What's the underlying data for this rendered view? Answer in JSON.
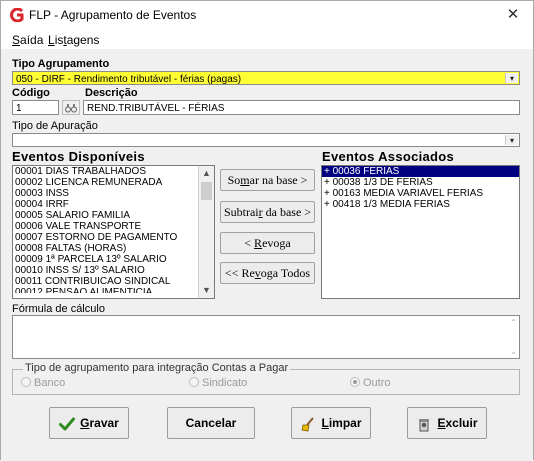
{
  "window": {
    "title": "FLP - Agrupamento de Eventos",
    "close_glyph": "✕"
  },
  "menu": {
    "items": [
      {
        "accel": "S",
        "rest": "aída"
      },
      {
        "accel": "L",
        "rest": "is",
        "accel2": "t",
        "rest2": "agens"
      }
    ]
  },
  "tipo_agrupamento": {
    "label": "Tipo Agrupamento",
    "value": "050 - DIRF - Rendimento tributável - férias (pagas)"
  },
  "codigo": {
    "label": "Código",
    "value": "1"
  },
  "descricao": {
    "label": "Descrição",
    "value": "REND.TRIBUTÁVEL - FÉRIAS"
  },
  "tipo_apuracao": {
    "label": "Tipo de Apuração",
    "value": ""
  },
  "eventos_disponiveis": {
    "label": "Eventos Disponíveis",
    "items": [
      "00001 DIAS TRABALHADOS",
      "00002 LICENCA REMUNERADA",
      "00003 INSS",
      "00004 IRRF",
      "00005 SALARIO FAMILIA",
      "00006 VALE TRANSPORTE",
      "00007 ESTORNO DE PAGAMENTO",
      "00008 FALTAS (HORAS)",
      "00009 1ª PARCELA 13º SALARIO",
      "00010 INSS S/ 13º SALARIO",
      "00011 CONTRIBUICAO SINDICAL",
      "00012 PENSAO ALIMENTICIA"
    ]
  },
  "eventos_associados": {
    "label": "Eventos Associados",
    "items": [
      "+ 00036 FERIAS",
      "+ 00038 1/3 DE FERIAS",
      "+ 00163 MEDIA VARIAVEL FERIAS",
      "+ 00418 1/3 MEDIA FERIAS"
    ],
    "selected_index": 0
  },
  "transfer_buttons": {
    "somar": {
      "pre": "So",
      "accel": "m",
      "post": "ar  na base >"
    },
    "subtrair": {
      "pre": "Subtrai",
      "accel": "r",
      "post": " da base >"
    },
    "revoga": {
      "pre": "< ",
      "accel": "R",
      "post": "evoga"
    },
    "revoga_todos": {
      "pre": "<< Re",
      "accel": "v",
      "post": "oga Todos"
    }
  },
  "formula": {
    "label": "Fórmula de cálculo",
    "value": ""
  },
  "integracao": {
    "legend": "Tipo de agrupamento para integração Contas a Pagar",
    "options": [
      "Banco",
      "Sindicato",
      "Outro"
    ],
    "selected": "Outro"
  },
  "footer_buttons": {
    "gravar": {
      "accel": "G",
      "rest": "ravar"
    },
    "cancelar": {
      "label": "Cancelar"
    },
    "limpar": {
      "accel": "L",
      "rest": "impar"
    },
    "excluir": {
      "accel": "E",
      "rest": "xcluir"
    }
  },
  "colors": {
    "combo_highlight": "#ffff33",
    "selection": "#000080",
    "app_icon_red": "#d9262c",
    "check_green": "#2e8b1e"
  },
  "icons": {
    "app": "app-logo-icon",
    "close": "close-icon",
    "search": "binoculars-icon",
    "dropdown": "chevron-down-icon",
    "gravar": "check-icon",
    "limpar": "broom-icon",
    "excluir": "delete-icon"
  }
}
